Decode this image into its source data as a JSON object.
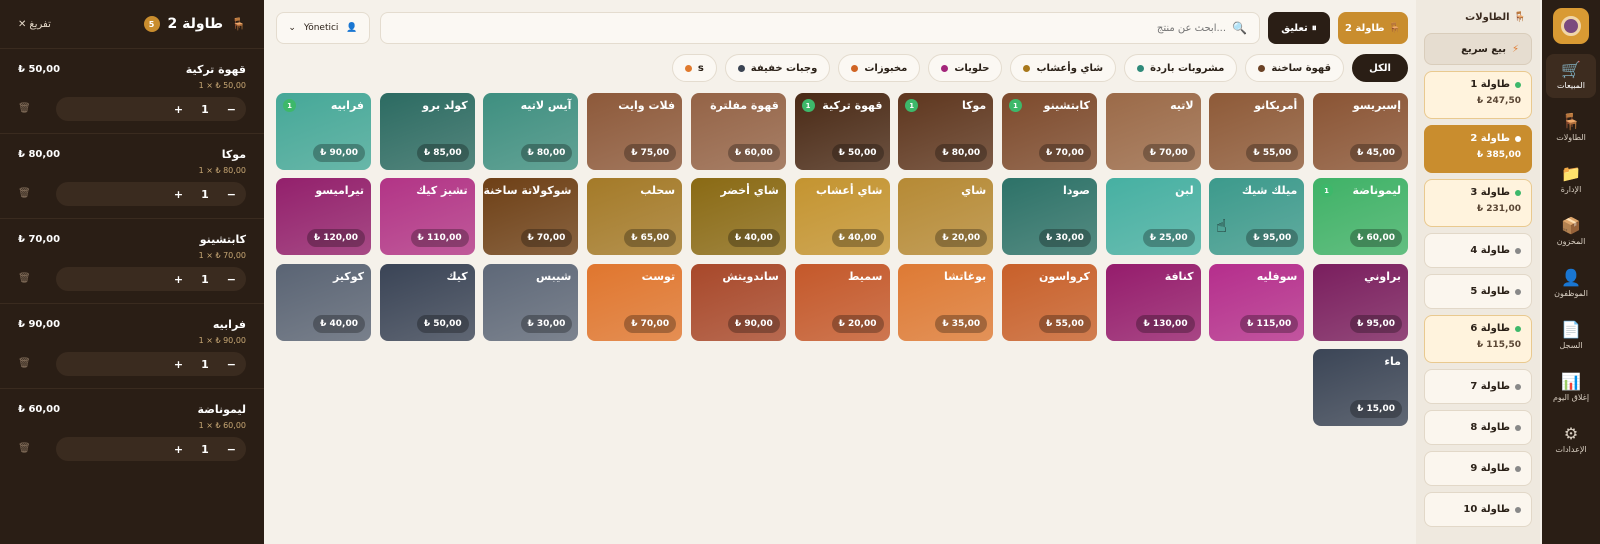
{
  "nav": {
    "items": [
      {
        "label": "المبيعات",
        "icon": "cart-icon",
        "glyph": "🛒",
        "active": true
      },
      {
        "label": "الطاولات",
        "icon": "chair-icon",
        "glyph": "🪑",
        "active": false
      },
      {
        "label": "الإدارة",
        "icon": "folder-icon",
        "glyph": "📁",
        "active": false
      },
      {
        "label": "المخزون",
        "icon": "box-icon",
        "glyph": "📦",
        "active": false
      },
      {
        "label": "الموظفون",
        "icon": "user-icon",
        "glyph": "👤",
        "active": false
      },
      {
        "label": "السجل",
        "icon": "document-icon",
        "glyph": "📄",
        "active": false
      },
      {
        "label": "إغلاق اليوم",
        "icon": "chart-icon",
        "glyph": "📊",
        "active": false
      },
      {
        "label": "الإعدادات",
        "icon": "gear-icon",
        "glyph": "⚙",
        "active": false
      }
    ]
  },
  "tables": {
    "header": "الطاولات",
    "quick_sale": "بيع سريع",
    "list": [
      {
        "name": "طاولة 1",
        "amount": "₺ 247,50",
        "state": "on"
      },
      {
        "name": "طاولة 2",
        "amount": "₺ 385,00",
        "state": "sel"
      },
      {
        "name": "طاولة 3",
        "amount": "₺ 231,00",
        "state": "on"
      },
      {
        "name": "طاولة 4",
        "amount": "",
        "state": "off"
      },
      {
        "name": "طاولة 5",
        "amount": "",
        "state": "off"
      },
      {
        "name": "طاولة 6",
        "amount": "₺ 115,50",
        "state": "on"
      },
      {
        "name": "طاولة 7",
        "amount": "",
        "state": "off"
      },
      {
        "name": "طاولة 8",
        "amount": "",
        "state": "off"
      },
      {
        "name": "طاولة 9",
        "amount": "",
        "state": "off"
      },
      {
        "name": "طاولة 10",
        "amount": "",
        "state": "off"
      }
    ]
  },
  "topbar": {
    "table_button": "طاولة 2",
    "hold_button": "تعليق",
    "search_placeholder": "ابحث عن منتج...",
    "user": "Yönetici"
  },
  "categories": [
    {
      "label": "الكل",
      "color": "",
      "all": true
    },
    {
      "label": "قهوة ساخنة",
      "color": "#6b4226"
    },
    {
      "label": "مشروبات باردة",
      "color": "#2f8a7a"
    },
    {
      "label": "شاي وأعشاب",
      "color": "#a8781c"
    },
    {
      "label": "حلويات",
      "color": "#a3257a"
    },
    {
      "label": "مخبوزات",
      "color": "#d06424"
    },
    {
      "label": "وجبات خفيفة",
      "color": "#3b4453"
    },
    {
      "label": "s",
      "color": "#e07a2e"
    }
  ],
  "products": [
    {
      "name": "إسبريسو",
      "price": "₺ 45,00",
      "color": "#8a5434",
      "badge": ""
    },
    {
      "name": "أمريكانو",
      "price": "₺ 55,00",
      "color": "#8e5a38",
      "badge": ""
    },
    {
      "name": "لاتيه",
      "price": "₺ 70,00",
      "color": "#9b6a48",
      "badge": ""
    },
    {
      "name": "كابتشينو",
      "price": "₺ 70,00",
      "color": "#7d4a2c",
      "badge": "1"
    },
    {
      "name": "موكا",
      "price": "₺ 80,00",
      "color": "#5e361e",
      "badge": "1"
    },
    {
      "name": "قهوة تركية",
      "price": "₺ 50,00",
      "color": "#4a2a16",
      "badge": "1"
    },
    {
      "name": "قهوة مفلترة",
      "price": "₺ 60,00",
      "color": "#946346",
      "badge": ""
    },
    {
      "name": "فلات وايت",
      "price": "₺ 75,00",
      "color": "#8d593a",
      "badge": ""
    },
    {
      "name": "آيس لاتيه",
      "price": "₺ 80,00",
      "color": "#3e8f80",
      "badge": ""
    },
    {
      "name": "كولد برو",
      "price": "₺ 85,00",
      "color": "#2c6b62",
      "badge": ""
    },
    {
      "name": "فرابيه",
      "price": "₺ 90,00",
      "color": "#45a898",
      "badge": "1"
    },
    {
      "name": "ليموناضة",
      "price": "₺ 60,00",
      "color": "#3fb267",
      "badge": "1"
    },
    {
      "name": "ميلك شيك",
      "price": "₺ 95,00",
      "color": "#3c9a8c",
      "badge": ""
    },
    {
      "name": "لبن",
      "price": "₺ 25,00",
      "color": "#46b0a2",
      "badge": ""
    },
    {
      "name": "صودا",
      "price": "₺ 30,00",
      "color": "#2d7268",
      "badge": ""
    },
    {
      "name": "شاي",
      "price": "₺ 20,00",
      "color": "#b68a35",
      "badge": ""
    },
    {
      "name": "شاي أعشاب",
      "price": "₺ 40,00",
      "color": "#c49430",
      "badge": ""
    },
    {
      "name": "شاي أخضر",
      "price": "₺ 40,00",
      "color": "#8a6a14",
      "badge": ""
    },
    {
      "name": "سحلب",
      "price": "₺ 65,00",
      "color": "#a47a28",
      "badge": ""
    },
    {
      "name": "شوكولاتة ساخنة",
      "price": "₺ 70,00",
      "color": "#6e4016",
      "badge": ""
    },
    {
      "name": "تشيز كيك",
      "price": "₺ 110,00",
      "color": "#b23486",
      "badge": ""
    },
    {
      "name": "تيراميسو",
      "price": "₺ 120,00",
      "color": "#93206c",
      "badge": ""
    },
    {
      "name": "براوني",
      "price": "₺ 95,00",
      "color": "#7a1e5e",
      "badge": ""
    },
    {
      "name": "سوفليه",
      "price": "₺ 115,00",
      "color": "#b52e8c",
      "badge": ""
    },
    {
      "name": "كنافة",
      "price": "₺ 130,00",
      "color": "#951c6c",
      "badge": ""
    },
    {
      "name": "كرواسون",
      "price": "₺ 55,00",
      "color": "#c8602a",
      "badge": ""
    },
    {
      "name": "بوغاتشا",
      "price": "₺ 35,00",
      "color": "#de7a34",
      "badge": ""
    },
    {
      "name": "سميط",
      "price": "₺ 20,00",
      "color": "#c4582a",
      "badge": ""
    },
    {
      "name": "ساندويتش",
      "price": "₺ 90,00",
      "color": "#a8482a",
      "badge": ""
    },
    {
      "name": "توست",
      "price": "₺ 70,00",
      "color": "#e0762e",
      "badge": ""
    },
    {
      "name": "شيبس",
      "price": "₺ 30,00",
      "color": "#5e6878",
      "badge": ""
    },
    {
      "name": "كيك",
      "price": "₺ 50,00",
      "color": "#3a4456",
      "badge": ""
    },
    {
      "name": "كوكيز",
      "price": "₺ 40,00",
      "color": "#5a6474",
      "badge": ""
    },
    {
      "name": "ماء",
      "price": "₺ 15,00",
      "color": "#3b4556",
      "badge": ""
    }
  ],
  "cart": {
    "title": "طاولة 2",
    "count": "5",
    "clear_label": "تفريغ",
    "lines": [
      {
        "name": "قهوة تركية",
        "total": "₺ 50,00",
        "unit": "1 × ₺ 50,00",
        "qty": "1"
      },
      {
        "name": "موكا",
        "total": "₺ 80,00",
        "unit": "1 × ₺ 80,00",
        "qty": "1"
      },
      {
        "name": "كابتشينو",
        "total": "₺ 70,00",
        "unit": "1 × ₺ 70,00",
        "qty": "1"
      },
      {
        "name": "فرابيه",
        "total": "₺ 90,00",
        "unit": "1 × ₺ 90,00",
        "qty": "1"
      },
      {
        "name": "ليموناضة",
        "total": "₺ 60,00",
        "unit": "1 × ₺ 60,00",
        "qty": "1"
      }
    ]
  }
}
